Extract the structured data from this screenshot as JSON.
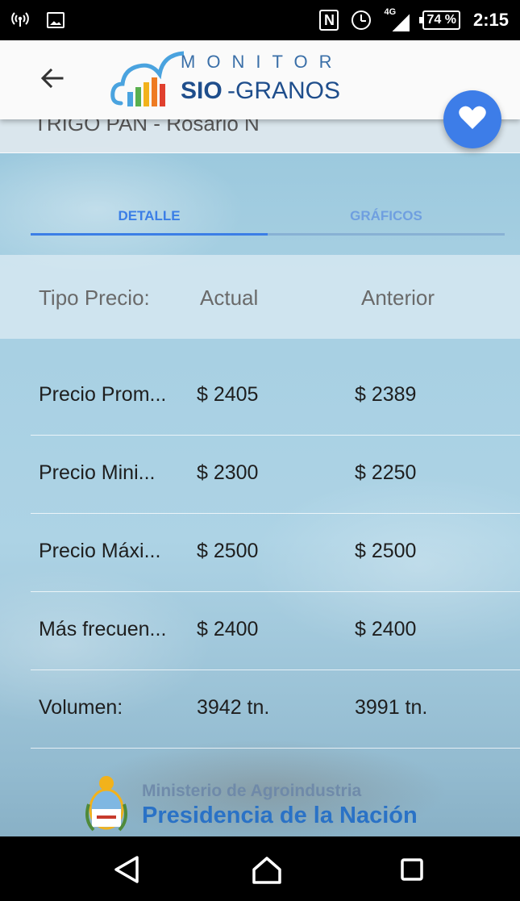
{
  "status_bar": {
    "network_type": "4G",
    "battery": "74 %",
    "time": "2:15",
    "icons": [
      "wifi-hotspot-icon",
      "image-icon",
      "nfc-icon",
      "alarm-icon",
      "signal-icon",
      "battery-icon"
    ]
  },
  "app_bar": {
    "back_icon": "arrow-left-icon",
    "logo_top": "MONITOR",
    "logo_bold": "SIO",
    "logo_rest": "-GRANOS"
  },
  "fab": {
    "icon": "heart-icon",
    "color": "#3d7de8"
  },
  "subtitle": "TRIGO PAN - Rosario N",
  "tabs": [
    {
      "label": "DETALLE",
      "active": true
    },
    {
      "label": "GRÁFICOS",
      "active": false
    }
  ],
  "table": {
    "headers": [
      "Tipo Precio:",
      "Actual",
      "Anterior"
    ],
    "rows": [
      [
        "Precio Prom...",
        "$ 2405",
        "$ 2389"
      ],
      [
        "Precio Mini...",
        "$ 2300",
        "$ 2250"
      ],
      [
        "Precio Máxi...",
        "$ 2500",
        "$ 2500"
      ],
      [
        "Más frecuen...",
        "$ 2400",
        "$ 2400"
      ],
      [
        "Volumen:",
        "3942 tn.",
        "3991 tn."
      ]
    ]
  },
  "footer": {
    "ministry": "Ministerio de Agroindustria",
    "presidency": "Presidencia de la Nación"
  },
  "nav_bar": {
    "icons": [
      "nav-back-icon",
      "nav-home-icon",
      "nav-recents-icon"
    ]
  },
  "colors": {
    "accent": "#3b7ee6",
    "brand": "#1f4e8c"
  }
}
